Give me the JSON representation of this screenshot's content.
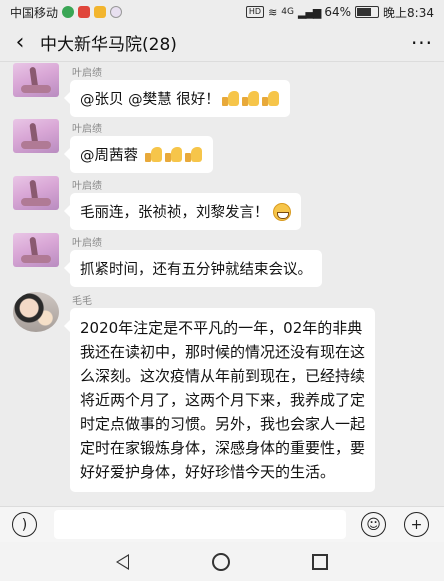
{
  "status_bar": {
    "carrier": "中国移动",
    "hd": "HD",
    "network": "4G",
    "battery": "64%",
    "battery_level": 0.64,
    "time": "晚上8:34"
  },
  "header": {
    "back_icon": "chevron-left-icon",
    "title": "中大新华马院(28)",
    "more_label": "···"
  },
  "messages": [
    {
      "sender": "叶启绩",
      "text": "@张贝  @樊慧  很好！",
      "emoji": [
        "thumbs-up",
        "thumbs-up",
        "thumbs-up"
      ]
    },
    {
      "sender": "叶启绩",
      "text": "@周茜蓉 ",
      "emoji": [
        "thumbs-up",
        "thumbs-up",
        "thumbs-up"
      ]
    },
    {
      "sender": "叶启绩",
      "text": "毛丽连，张祯祯，刘黎发言！",
      "emoji": [
        "grin"
      ]
    },
    {
      "sender": "叶启绩",
      "text": "抓紧时间，还有五分钟就结束会议。",
      "emoji": []
    },
    {
      "sender": "毛毛",
      "text": "2020年注定是不平凡的一年，02年的非典我还在读初中，那时候的情况还没有现在这么深刻。这次疫情从年前到现在，已经持续将近两个月了，这两个月下来，我养成了定时定点做事的习惯。另外，我也会家人一起定时在家锻炼身体，深感身体的重要性，要好好爱护身体，好好珍惜今天的生活。",
      "emoji": []
    }
  ],
  "input_bar": {
    "voice_icon": "voice-icon",
    "emoji_icon": "smiley-icon",
    "plus_icon": "plus-icon",
    "placeholder": ""
  },
  "nav_bar": {
    "back_icon": "triangle-back-icon",
    "home_icon": "circle-home-icon",
    "recent_icon": "square-recent-icon"
  }
}
